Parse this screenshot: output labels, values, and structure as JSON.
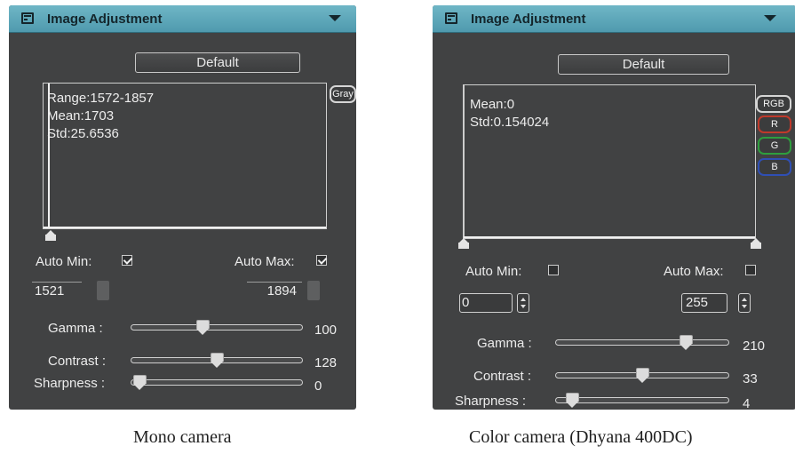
{
  "mono": {
    "header": {
      "title": "Image Adjustment"
    },
    "default_button": "Default",
    "histogram": {
      "range": "Range:1572-1857",
      "mean": "Mean:1703",
      "std": "Std:25.6536",
      "channel_button": "Gray"
    },
    "auto_min": {
      "label": "Auto Min:",
      "checked": true
    },
    "auto_max": {
      "label": "Auto Max:",
      "checked": true
    },
    "min_value": "1521",
    "max_value": "1894",
    "gamma": {
      "label": "Gamma :",
      "value": "100",
      "level": 0.41
    },
    "contrast": {
      "label": "Contrast :",
      "value": "128",
      "level": 0.5
    },
    "sharpness": {
      "label": "Sharpness :",
      "value": "0",
      "level": 0.0
    },
    "caption": "Mono camera"
  },
  "color": {
    "header": {
      "title": "Image Adjustment"
    },
    "default_button": "Default",
    "histogram": {
      "mean": "Mean:0",
      "std": "Std:0.154024",
      "channel_buttons": [
        "RGB",
        "R",
        "G",
        "B"
      ]
    },
    "auto_min": {
      "label": "Auto Min:",
      "checked": false
    },
    "auto_max": {
      "label": "Auto Max:",
      "checked": false
    },
    "min_value": "0",
    "max_value": "255",
    "gamma": {
      "label": "Gamma :",
      "value": "210",
      "level": 0.78
    },
    "contrast": {
      "label": "Contrast :",
      "value": "33",
      "level": 0.5
    },
    "sharpness": {
      "label": "Sharpness :",
      "value": "4",
      "level": 0.05
    },
    "caption": "Color camera (Dhyana 400DC)"
  },
  "colors": {
    "panel_bg": "#414243",
    "header_bg": "#5aa6b8",
    "rgb_red": "#c0392b",
    "rgb_green": "#2e9e3e",
    "rgb_blue": "#2f4fb5"
  }
}
